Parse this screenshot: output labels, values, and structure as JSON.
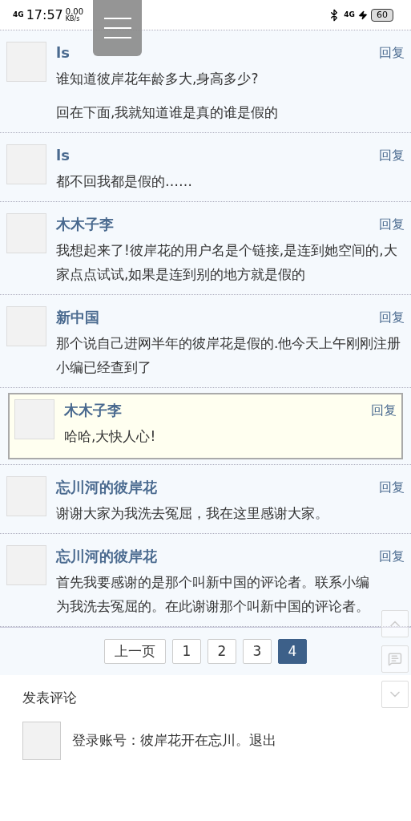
{
  "status_bar": {
    "network": "4G",
    "time": "17:57",
    "speed": "0.00",
    "speed_unit": "KB/s",
    "mobile": "4G",
    "battery": "60"
  },
  "comments": [
    {
      "kind": "comment",
      "author": "ls",
      "reply": "回复",
      "paragraphs": [
        "谁知道彼岸花年龄多大,身高多少?",
        "回在下面,我就知道谁是真的谁是假的"
      ]
    },
    {
      "kind": "comment",
      "author": "ls",
      "reply": "回复",
      "paragraphs": [
        "都不回我都是假的……"
      ]
    },
    {
      "kind": "comment",
      "author": "木木子李",
      "reply": "回复",
      "paragraphs": [
        "我想起来了!彼岸花的用户名是个链接,是连到她空间的,大家点点试试,如果是连到别的地方就是假的"
      ]
    },
    {
      "kind": "comment",
      "author": "新中国",
      "reply": "回复",
      "paragraphs": [
        "那个说自己进网半年的彼岸花是假的.他今天上午刚刚注册小编已经查到了"
      ]
    },
    {
      "kind": "quoted",
      "author": "木木子李",
      "reply": "回复",
      "paragraphs": [
        "哈哈,大快人心!"
      ]
    },
    {
      "kind": "comment",
      "author": "忘川河的彼岸花",
      "reply": "回复",
      "paragraphs": [
        "谢谢大家为我洗去冤屈，我在这里感谢大家。"
      ]
    },
    {
      "kind": "comment",
      "author": "忘川河的彼岸花",
      "reply": "回复",
      "paragraphs": [
        "首先我要感谢的是那个叫新中国的评论者。联系小编为我洗去冤屈的。在此谢谢那个叫新中国的评论者。"
      ]
    }
  ],
  "pagination": {
    "prev": "上一页",
    "pages": [
      {
        "label": "1",
        "selected": false
      },
      {
        "label": "2",
        "selected": false
      },
      {
        "label": "3",
        "selected": false
      },
      {
        "label": "4",
        "selected": true
      }
    ]
  },
  "post_comment": {
    "title": "发表评论",
    "login_label": "登录账号：",
    "username": "彼岸花开在忘川。",
    "logout": "退出"
  }
}
